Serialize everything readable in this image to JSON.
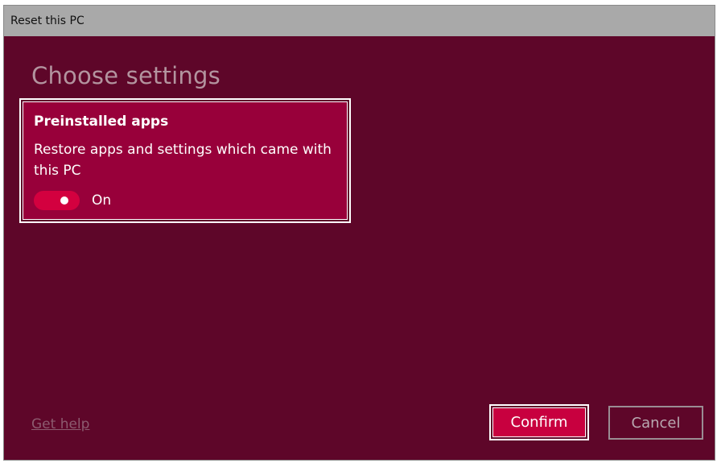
{
  "window": {
    "title": "Reset this PC"
  },
  "main": {
    "heading": "Choose settings",
    "option": {
      "title": "Preinstalled apps",
      "description": "Restore apps and settings which came with this PC",
      "toggle_state": "On",
      "toggle_on": true
    }
  },
  "footer": {
    "help_link": "Get help",
    "confirm_label": "Confirm",
    "cancel_label": "Cancel"
  },
  "colors": {
    "background": "#5e0629",
    "card": "#98003a",
    "accent": "#c8003f",
    "titlebar": "#a9a9a9"
  }
}
